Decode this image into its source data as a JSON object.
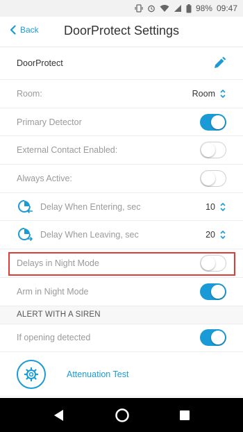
{
  "status_bar": {
    "battery": "98%",
    "time": "09:47"
  },
  "header": {
    "back_label": "Back",
    "title": "DoorProtect Settings"
  },
  "name_row": {
    "label": "DoorProtect"
  },
  "room_row": {
    "label": "Room:",
    "value": "Room"
  },
  "primary_detector": {
    "label": "Primary Detector",
    "on": true
  },
  "external_contact": {
    "label": "External Contact Enabled:",
    "on": false
  },
  "always_active": {
    "label": "Always Active:",
    "on": false
  },
  "delay_entering": {
    "label": "Delay When Entering, sec",
    "value": "10"
  },
  "delay_leaving": {
    "label": "Delay When Leaving, sec",
    "value": "20"
  },
  "delays_night": {
    "label": "Delays in Night Mode",
    "on": false
  },
  "arm_night": {
    "label": "Arm in Night Mode",
    "on": true
  },
  "siren_section": {
    "header": "ALERT WITH A SIREN"
  },
  "if_opening": {
    "label": "If opening detected",
    "on": true
  },
  "attenuation": {
    "label": "Attenuation Test"
  },
  "colors": {
    "accent": "#1a9bd7",
    "highlight": "#e53935"
  },
  "icons": [
    "back-chevron-icon",
    "edit-pencil-icon",
    "updown-chevron-icon",
    "timer-enter-icon",
    "timer-leave-icon",
    "gear-icon",
    "back-triangle-icon",
    "home-circle-icon",
    "recents-square-icon"
  ]
}
